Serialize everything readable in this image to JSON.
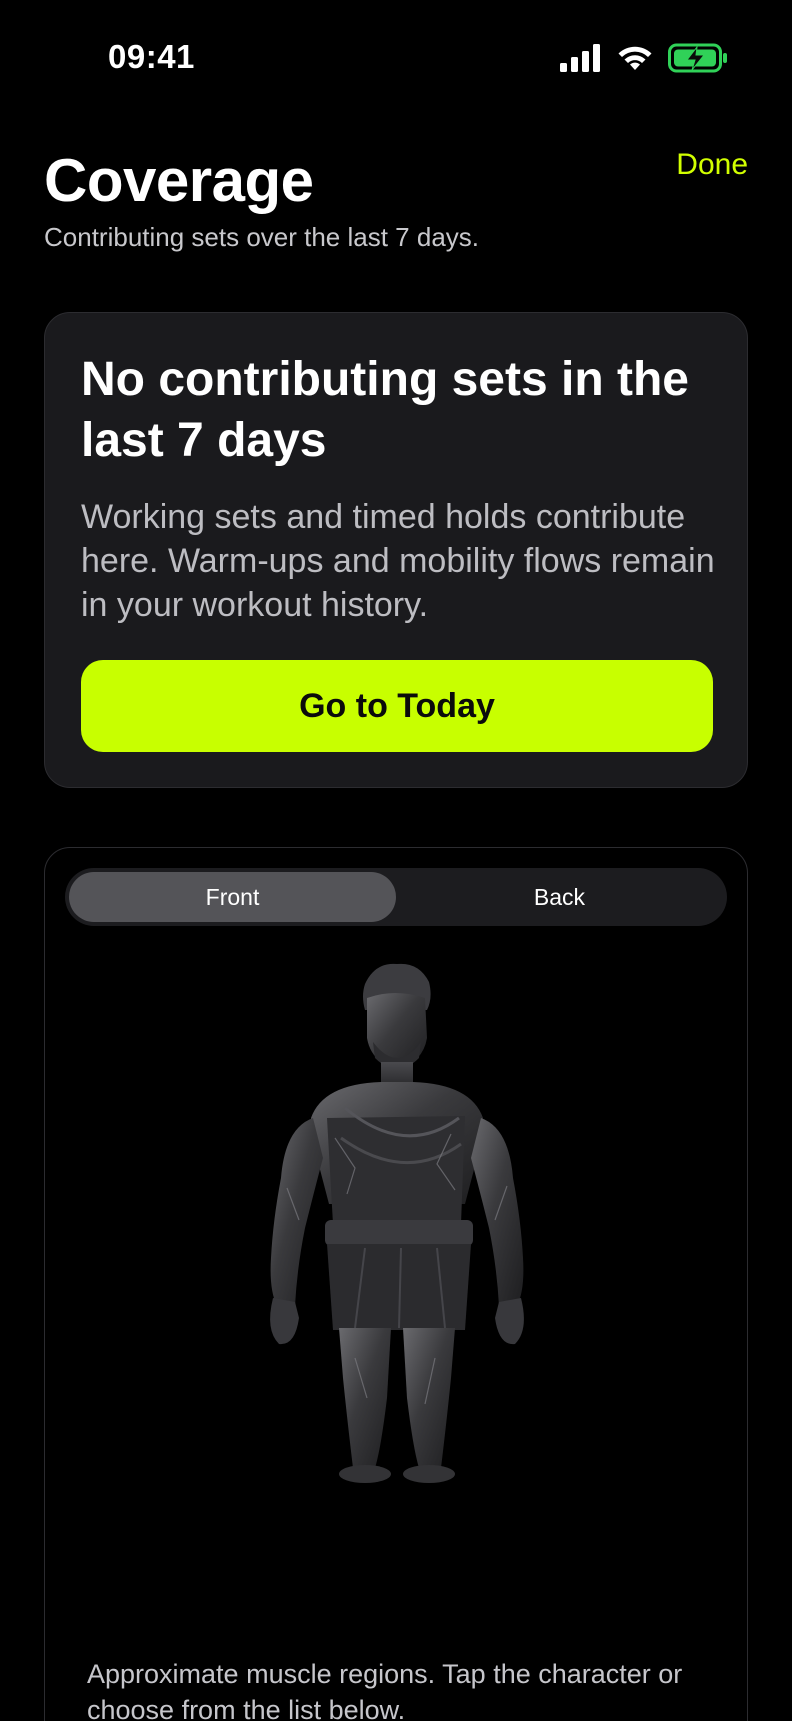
{
  "status_bar": {
    "time": "09:41",
    "icons": [
      "signal-icon",
      "wifi-icon",
      "battery-charging-icon"
    ],
    "battery_color": "#30d158"
  },
  "header": {
    "title": "Coverage",
    "subtitle": "Contributing sets over the last 7 days.",
    "done_label": "Done"
  },
  "empty_state": {
    "title": "No contributing sets in the last 7 days",
    "body": "Working sets and timed holds contribute here. Warm-ups and mobility flows remain in your workout history.",
    "button_label": "Go to Today"
  },
  "body_map": {
    "tabs": [
      {
        "label": "Front",
        "selected": true
      },
      {
        "label": "Back",
        "selected": false
      }
    ],
    "figure_icon": "marble-hero-figure",
    "caption": "Approximate muscle regions. Tap the character or choose from the list below."
  },
  "colors": {
    "accent": "#c8ff00",
    "done_text": "#d2ff00",
    "card_bg": "#1a1a1d",
    "background": "#000000"
  }
}
